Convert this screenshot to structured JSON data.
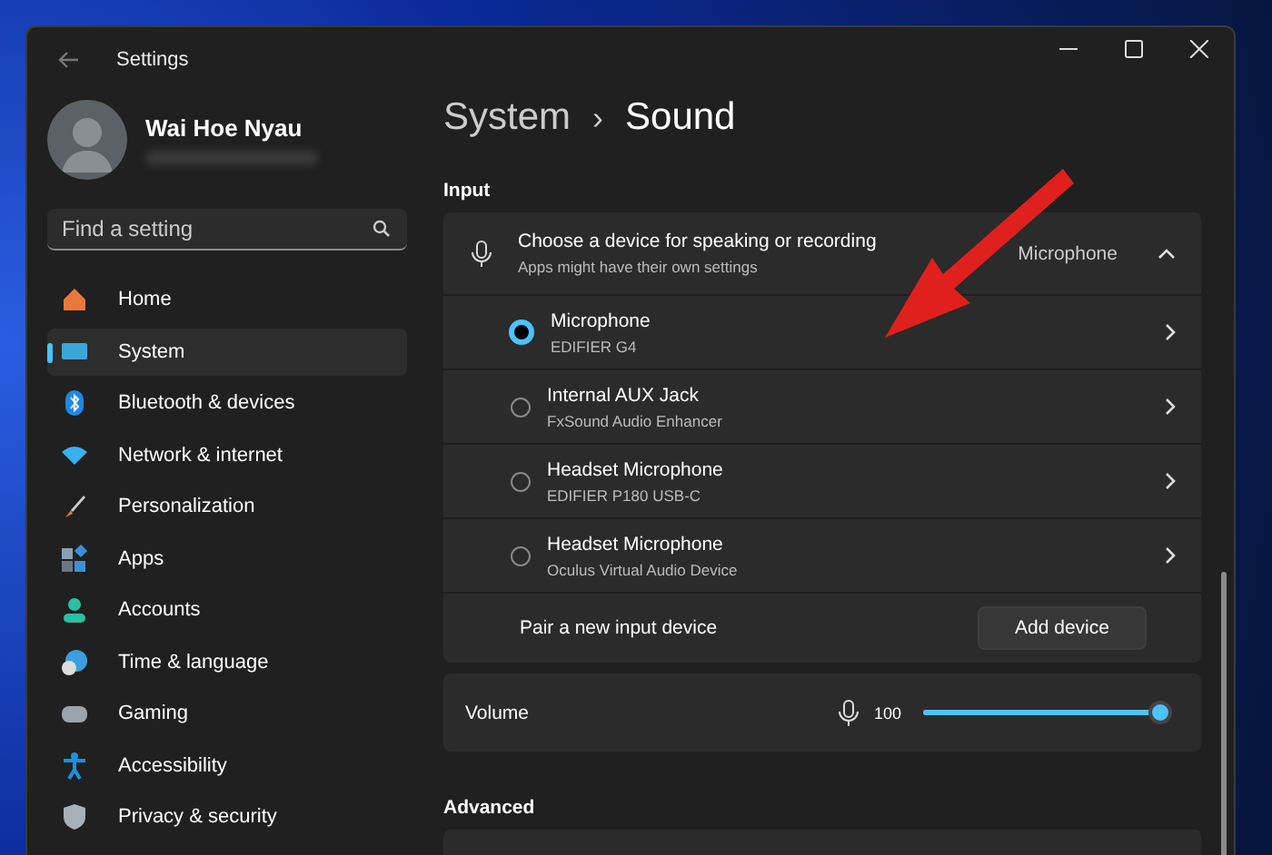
{
  "window": {
    "title": "Settings"
  },
  "profile": {
    "name": "Wai Hoe Nyau"
  },
  "search": {
    "placeholder": "Find a setting"
  },
  "nav": [
    {
      "label": "Home",
      "kind": "home",
      "selected": false
    },
    {
      "label": "System",
      "kind": "system",
      "selected": true
    },
    {
      "label": "Bluetooth & devices",
      "kind": "bluetooth",
      "selected": false
    },
    {
      "label": "Network & internet",
      "kind": "network",
      "selected": false
    },
    {
      "label": "Personalization",
      "kind": "brush",
      "selected": false
    },
    {
      "label": "Apps",
      "kind": "apps",
      "selected": false
    },
    {
      "label": "Accounts",
      "kind": "accounts",
      "selected": false
    },
    {
      "label": "Time & language",
      "kind": "time",
      "selected": false
    },
    {
      "label": "Gaming",
      "kind": "gaming",
      "selected": false
    },
    {
      "label": "Accessibility",
      "kind": "accessibility",
      "selected": false
    },
    {
      "label": "Privacy & security",
      "kind": "privacy",
      "selected": false
    }
  ],
  "breadcrumb": {
    "parent": "System",
    "separator": "›",
    "current": "Sound"
  },
  "input_section": {
    "heading": "Input",
    "chooser": {
      "title": "Choose a device for speaking or recording",
      "subtitle": "Apps might have their own settings",
      "value": "Microphone",
      "expanded": true
    },
    "devices": [
      {
        "name": "Microphone",
        "detail": "EDIFIER G4",
        "selected": true
      },
      {
        "name": "Internal AUX Jack",
        "detail": "FxSound Audio Enhancer",
        "selected": false
      },
      {
        "name": "Headset Microphone",
        "detail": "EDIFIER P180 USB-C",
        "selected": false
      },
      {
        "name": "Headset Microphone",
        "detail": "Oculus Virtual Audio Device",
        "selected": false
      }
    ],
    "pair": {
      "label": "Pair a new input device",
      "button": "Add device"
    },
    "volume": {
      "label": "Volume",
      "reading": "100",
      "level": 1.0
    }
  },
  "advanced_section": {
    "heading": "Advanced"
  }
}
